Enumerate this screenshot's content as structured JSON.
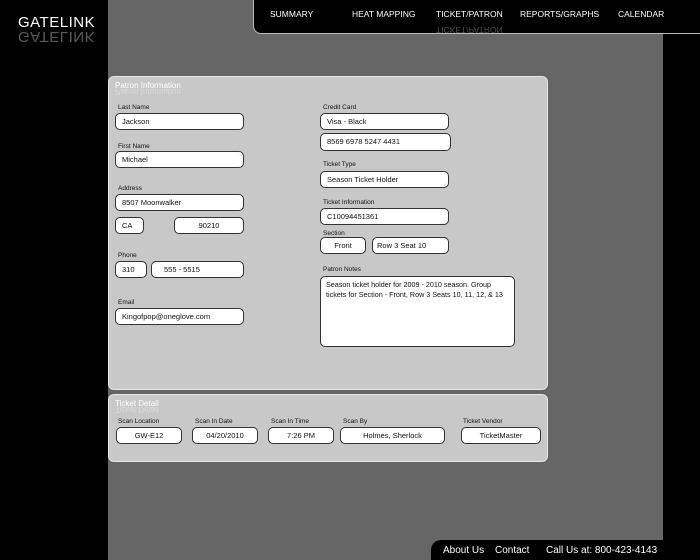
{
  "brand": {
    "logo_text": "GATELINK"
  },
  "nav": {
    "summary": "SUMMARY",
    "heat_mapping": "HEAT MAPPING",
    "ticket_patron": "TICKET/PATRON",
    "reports_graphs": "REPORTS/GRAPHS",
    "calendar": "CALENDAR"
  },
  "patron": {
    "title": "Patron Information",
    "last_name_label": "Last Name",
    "last_name": "Jackson",
    "first_name_label": "First Name",
    "first_name": "Michael",
    "address_label": "Address",
    "street": "8507 Moonwalker",
    "state": "CA",
    "zip": "90210",
    "phone_label": "Phone",
    "phone_area": "310",
    "phone_number": "555 - 5515",
    "email_label": "Email",
    "email": "Kingofpop@oneglove.com",
    "credit_card_label": "Credit Card",
    "card_type": "Visa - Black",
    "card_number": "8569  6978  5247  4431",
    "ticket_type_label": "Ticket Type",
    "ticket_type": "Season Ticket Holder",
    "ticket_info_label": "Ticket Information",
    "ticket_info": "C10094451361",
    "section_label": "Section",
    "section": "Front",
    "row_seat": "Row 3   Seat  10",
    "notes_label": "Patron Notes",
    "notes": "Season ticket holder for 2009 - 2010 season. Group tickets for Section - Front, Row 3 Seats 10, 11, 12, & 13"
  },
  "ticket_detail": {
    "title": "Ticket Detail",
    "scan_location_label": "Scan Location",
    "scan_location": "GW-E12",
    "scan_date_label": "Scan In Date",
    "scan_date": "04/20/2010",
    "scan_time_label": "Scan In Time",
    "scan_time": "7:26 PM",
    "scan_by_label": "Scan By",
    "scan_by": "Holmes, Sherlock",
    "vendor_label": "Ticket Vendor",
    "vendor": "TicketMaster"
  },
  "footer": {
    "about": "About Us",
    "contact": "Contact",
    "call": "Call Us at:  800-423-4143"
  }
}
